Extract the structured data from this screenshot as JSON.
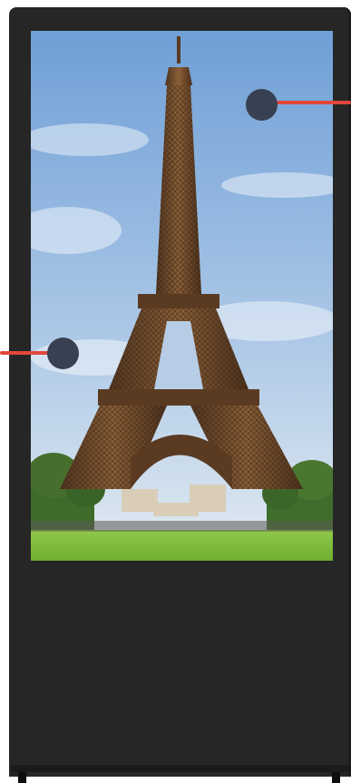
{
  "colors": {
    "kiosk_body": "#262626",
    "callout_dot": "#374151",
    "callout_line": "#e0473b",
    "sky_top": "#6f9fd6",
    "sky_bottom": "#dbe6ef",
    "grass": "#7fbf3a",
    "tower": "#7a5230"
  },
  "icons": {
    "callout_top": "callout-marker-icon",
    "callout_left": "callout-marker-icon"
  }
}
